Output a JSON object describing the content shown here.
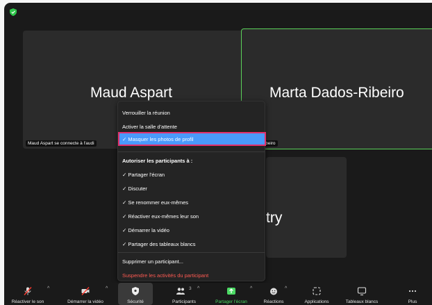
{
  "participants": {
    "tile1": {
      "name": "Maud Aspart",
      "caption": "Maud Aspart se connecte à l'audi"
    },
    "tile2": {
      "name": "Marta Dados-Ribeiro",
      "caption": "Dados-Ribeiro"
    },
    "tile3": {
      "name": "try"
    }
  },
  "security_menu": {
    "lock_meeting": "Verrouiller la réunion",
    "enable_waiting_room": "Activer la salle d'attente",
    "hide_profile_pictures": "✓ Masquer les photos de profil",
    "allow_header": "Autoriser les participants à :",
    "share_screen": "✓ Partager l'écran",
    "chat": "✓ Discuter",
    "rename_self": "✓ Se renommer eux-mêmes",
    "unmute_self": "✓ Réactiver eux-mêmes leur son",
    "start_video": "✓ Démarrer la vidéo",
    "share_whiteboards": "✓ Partager des tableaux blancs",
    "remove_participant": "Supprimer un participant...",
    "suspend_activities": "Suspendre les activités du participant"
  },
  "toolbar": {
    "audio": "Réactiver le son",
    "video": "Démarrer la vidéo",
    "security": "Sécurité",
    "participants": "Participants",
    "participants_count": "3",
    "share": "Partager l'écran",
    "reactions": "Réactions",
    "apps": "Applications",
    "whiteboards": "Tableaux blancs",
    "more": "Plus"
  },
  "colors": {
    "accent_green": "#4cd964",
    "highlight": "#4a9afc",
    "highlight_border": "#e3306c",
    "danger": "#ff5a52"
  }
}
